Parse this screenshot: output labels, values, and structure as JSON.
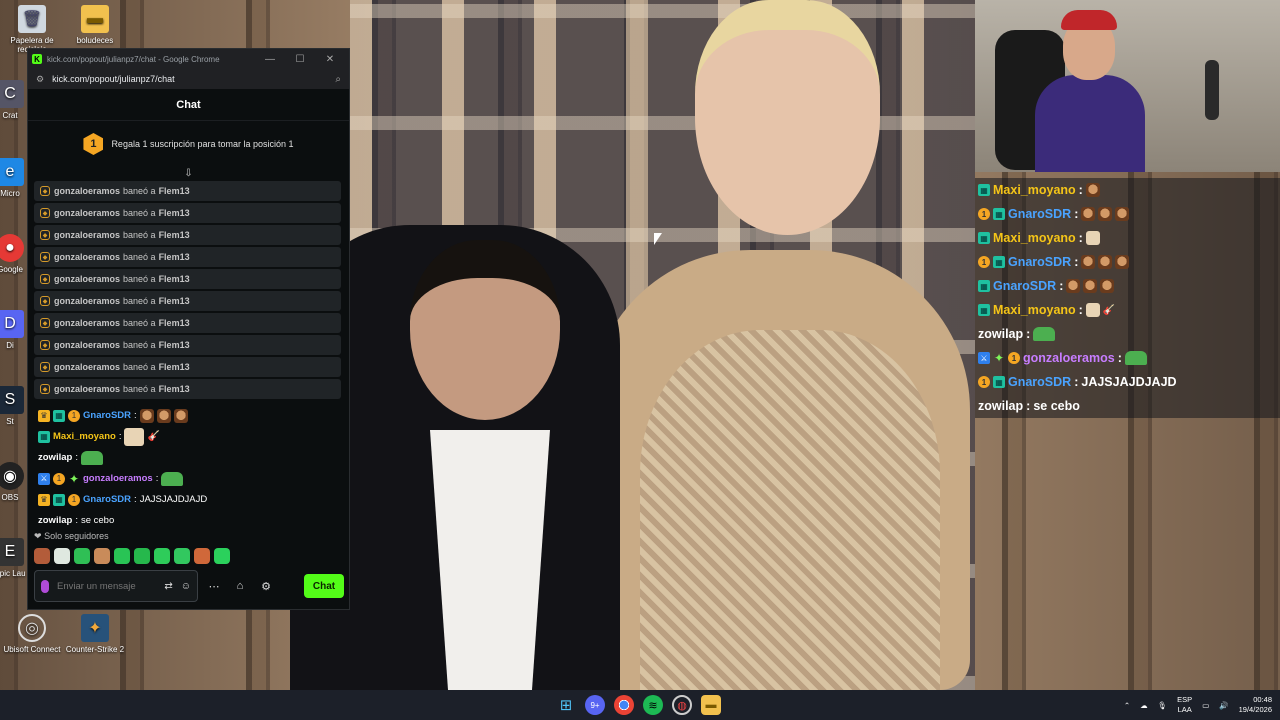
{
  "desktop": {
    "icons": [
      {
        "label": "Papelera de reciclaje",
        "icon": "recycle-bin-icon"
      },
      {
        "label": "boludeces",
        "icon": "folder-icon"
      },
      {
        "label": "Crat",
        "icon": "app-icon"
      },
      {
        "label": "Micro",
        "icon": "edge-icon"
      },
      {
        "label": "Google",
        "icon": "chrome-icon"
      },
      {
        "label": "Di",
        "icon": "app-icon"
      },
      {
        "label": "St",
        "icon": "steam-icon"
      },
      {
        "label": "OBS",
        "icon": "obs-icon"
      },
      {
        "label": "Epic Lau",
        "icon": "epic-icon"
      },
      {
        "label": "Ubisoft Connect",
        "icon": "ubisoft-icon"
      },
      {
        "label": "Counter-Strike 2",
        "icon": "cs2-icon"
      }
    ]
  },
  "browser": {
    "title": "kick.com/popout/julianpz7/chat - Google Chrome",
    "url": "kick.com/popout/julianpz7/chat",
    "favicon": "K",
    "minimize": "—",
    "maximize": "☐",
    "close": "✕"
  },
  "chat": {
    "header": "Chat",
    "promo": {
      "position": "1",
      "text": "Regala 1 suscripción para tomar la posición 1"
    },
    "bans": [
      {
        "moderator": "gonzaloeramos",
        "action": "baneó a",
        "target": "Flem13"
      },
      {
        "moderator": "gonzaloeramos",
        "action": "baneó a",
        "target": "Flem13"
      },
      {
        "moderator": "gonzaloeramos",
        "action": "baneó a",
        "target": "Flem13"
      },
      {
        "moderator": "gonzaloeramos",
        "action": "baneó a",
        "target": "Flem13"
      },
      {
        "moderator": "gonzaloeramos",
        "action": "baneó a",
        "target": "Flem13"
      },
      {
        "moderator": "gonzaloeramos",
        "action": "baneó a",
        "target": "Flem13"
      },
      {
        "moderator": "gonzaloeramos",
        "action": "baneó a",
        "target": "Flem13"
      },
      {
        "moderator": "gonzaloeramos",
        "action": "baneó a",
        "target": "Flem13"
      },
      {
        "moderator": "gonzaloeramos",
        "action": "baneó a",
        "target": "Flem13"
      },
      {
        "moderator": "gonzaloeramos",
        "action": "baneó a",
        "target": "Flem13"
      }
    ],
    "messages": [
      {
        "user": "GnaroSDR",
        "sep": ":",
        "text": "",
        "color": "#4aa3ff"
      },
      {
        "user": "Maxi_moyano",
        "sep": ":",
        "text": "",
        "color": "#f5c518"
      },
      {
        "user": "zowilap",
        "sep": ":",
        "text": "",
        "color": "#ffffff"
      },
      {
        "user": "gonzaloeramos",
        "sep": ":",
        "text": "",
        "color": "#c77dff"
      },
      {
        "user": "GnaroSDR",
        "sep": ":",
        "text": "JAJSJAJDJAJD",
        "color": "#4aa3ff"
      },
      {
        "user": "zowilap",
        "sep": ":",
        "text": "se cebo",
        "color": "#ffffff"
      }
    ],
    "followers_only": "Solo seguidores",
    "input_placeholder": "Enviar un mensaje",
    "send_label": "Chat"
  },
  "overlay": {
    "messages": [
      {
        "user": "Maxi_moyano",
        "sep": " :",
        "text": "",
        "color": "#f5c518"
      },
      {
        "user": "GnaroSDR",
        "sep": " :",
        "text": "",
        "color": "#4aa3ff"
      },
      {
        "user": "Maxi_moyano",
        "sep": " :",
        "text": "",
        "color": "#f5c518"
      },
      {
        "user": "GnaroSDR",
        "sep": " :",
        "text": "",
        "color": "#4aa3ff"
      },
      {
        "user": "GnaroSDR",
        "sep": " :",
        "text": "",
        "color": "#4aa3ff"
      },
      {
        "user": "Maxi_moyano",
        "sep": " :",
        "text": "",
        "color": "#f5c518"
      },
      {
        "user": "zowilap",
        "sep": " :",
        "text": "",
        "color": "#ffffff"
      },
      {
        "user": "gonzaloeramos",
        "sep": " :",
        "text": "",
        "color": "#c77dff"
      },
      {
        "user": "GnaroSDR",
        "sep": " :",
        "text": "JAJSJAJDJAJD",
        "color": "#4aa3ff"
      },
      {
        "user": "zowilap",
        "sep": " :",
        "text": "se cebo",
        "color": "#ffffff"
      }
    ]
  },
  "taskbar": {
    "apps": [
      "windows-start-icon",
      "discord-icon",
      "chrome-icon",
      "spotify-icon",
      "app-icon",
      "file-explorer-icon"
    ],
    "discord_badge": "9+",
    "language": "ESP",
    "layout": "LAA",
    "time": "00:48",
    "date": "19/4/2026"
  }
}
